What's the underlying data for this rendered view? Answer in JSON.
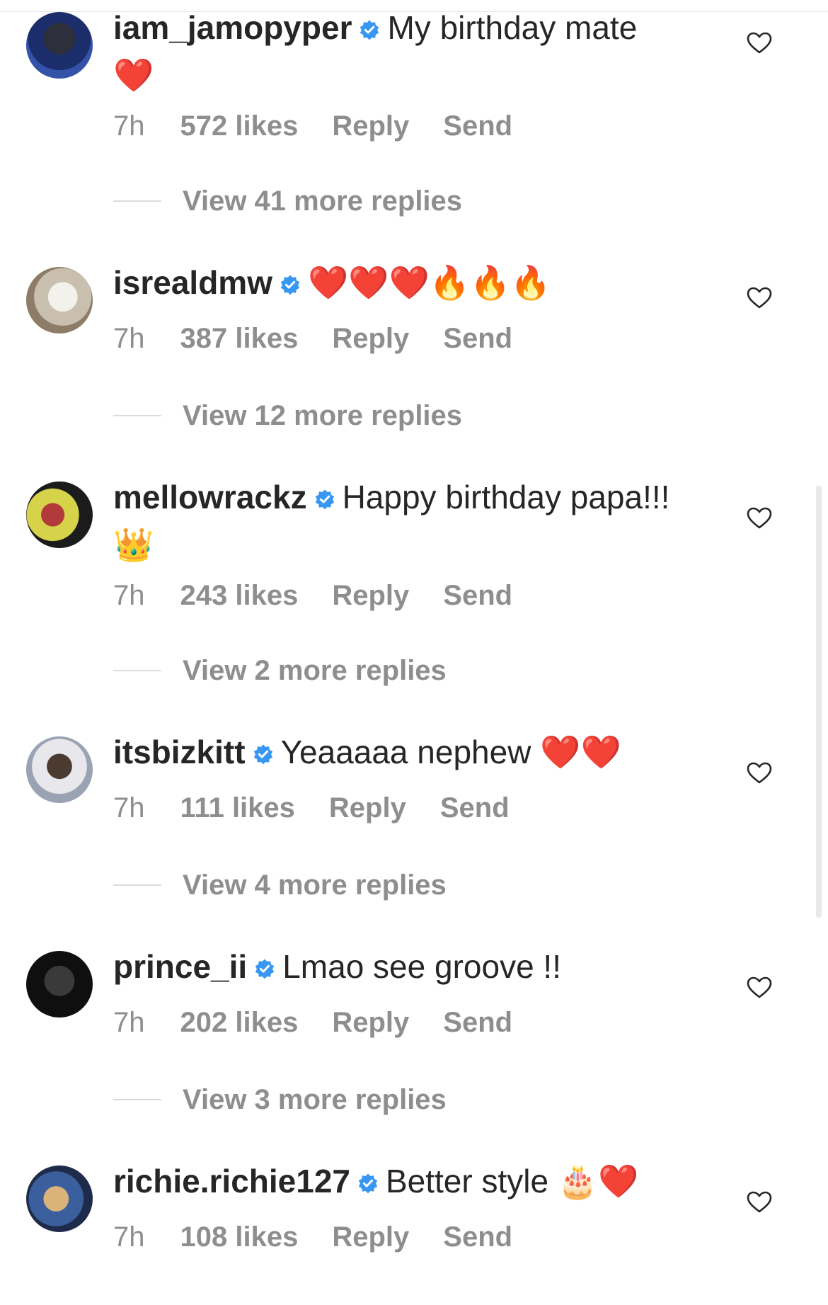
{
  "comments": [
    {
      "username": "iam_jamopyper",
      "text": "My birthday mate",
      "emoji": "❤️",
      "time": "7h",
      "likes": "572 likes",
      "reply": "Reply",
      "send": "Send",
      "view_replies": "View 41 more replies"
    },
    {
      "username": "isrealdmw",
      "text": "",
      "emoji": "❤️❤️❤️🔥🔥🔥",
      "time": "7h",
      "likes": "387 likes",
      "reply": "Reply",
      "send": "Send",
      "view_replies": "View 12 more replies"
    },
    {
      "username": "mellowrackz",
      "text": "Happy birthday papa!!!",
      "emoji": "👑",
      "time": "7h",
      "likes": "243 likes",
      "reply": "Reply",
      "send": "Send",
      "view_replies": "View 2 more replies"
    },
    {
      "username": "itsbizkitt",
      "text": "Yeaaaaa nephew",
      "emoji": "❤️❤️",
      "time": "7h",
      "likes": "111 likes",
      "reply": "Reply",
      "send": "Send",
      "view_replies": "View 4 more replies"
    },
    {
      "username": "prince_ii",
      "text": "Lmao see groove !!",
      "emoji": "",
      "time": "7h",
      "likes": "202 likes",
      "reply": "Reply",
      "send": "Send",
      "view_replies": "View 3 more replies"
    },
    {
      "username": "richie.richie127",
      "text": "Better style",
      "emoji": "🎂❤️",
      "time": "7h",
      "likes": "108 likes",
      "reply": "Reply",
      "send": "Send",
      "view_replies": ""
    }
  ],
  "icons": {
    "verified": "verified-badge-icon",
    "like": "heart-outline-icon"
  },
  "colors": {
    "text": "#262626",
    "secondary": "#8e8e8e",
    "verified_blue": "#3897f0"
  }
}
